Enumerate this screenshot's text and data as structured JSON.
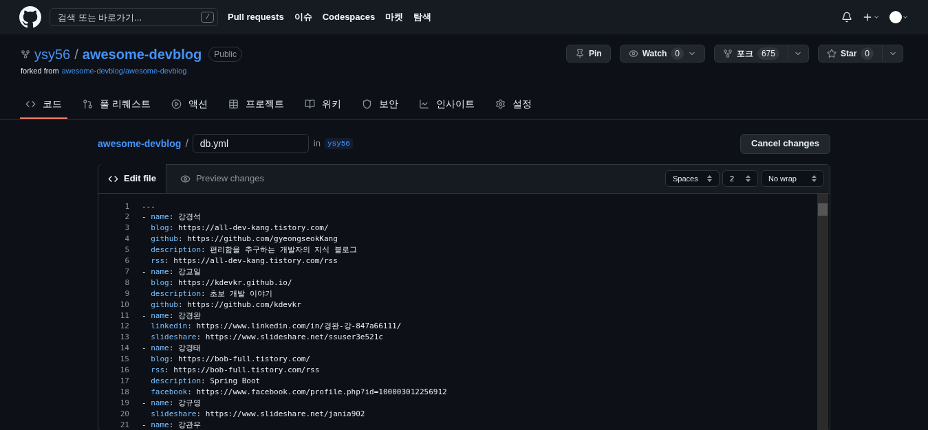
{
  "header": {
    "search_placeholder": "검색 또는 바로가기...",
    "search_key": "/",
    "nav": [
      "Pull requests",
      "이슈",
      "Codespaces",
      "마켓",
      "탐색"
    ]
  },
  "repo": {
    "owner": "ysy56",
    "separator": "/",
    "name": "awesome-devblog",
    "visibility": "Public",
    "forked_label": "forked from",
    "forked_link": "awesome-devblog/awesome-devblog",
    "actions": [
      {
        "kind": "pin",
        "label": "Pin"
      },
      {
        "kind": "watch",
        "label": "Watch",
        "count": "0"
      },
      {
        "kind": "fork",
        "label": "포크",
        "count": "675"
      },
      {
        "kind": "star",
        "label": "Star",
        "count": "0"
      }
    ]
  },
  "tabs": [
    {
      "kind": "code",
      "label": "코드",
      "selected": true
    },
    {
      "kind": "pr",
      "label": "풀 리퀘스트",
      "selected": false
    },
    {
      "kind": "actions",
      "label": "액션",
      "selected": false
    },
    {
      "kind": "projects",
      "label": "프로젝트",
      "selected": false
    },
    {
      "kind": "wiki",
      "label": "위키",
      "selected": false
    },
    {
      "kind": "security",
      "label": "보안",
      "selected": false
    },
    {
      "kind": "insights",
      "label": "인사이트",
      "selected": false
    },
    {
      "kind": "settings",
      "label": "설정",
      "selected": false
    }
  ],
  "editor": {
    "repo_link": "awesome-devblog",
    "separator": "/",
    "filename": "db.yml",
    "in_label": "in",
    "branch": "ysy56",
    "cancel": "Cancel changes",
    "modes": [
      {
        "kind": "edit",
        "label": "Edit file",
        "selected": true
      },
      {
        "kind": "preview",
        "label": "Preview changes",
        "selected": false
      }
    ],
    "selects": [
      "Spaces",
      "2",
      "No wrap"
    ],
    "lines": [
      {
        "number": "1",
        "text": "---"
      },
      {
        "number": "2",
        "dash": "-",
        "key": "name",
        "colon": ":",
        "value": "강경석"
      },
      {
        "number": "3",
        "key": "blog",
        "colon": ":",
        "value": "https://all-dev-kang.tistory.com/"
      },
      {
        "number": "4",
        "key": "github",
        "colon": ":",
        "value": "https://github.com/gyeongseokKang"
      },
      {
        "number": "5",
        "key": "description",
        "colon": ":",
        "value": "편리함을 추구하는 개발자의 지식 블로그"
      },
      {
        "number": "6",
        "key": "rss",
        "colon": ":",
        "value": "https://all-dev-kang.tistory.com/rss"
      },
      {
        "number": "7",
        "dash": "-",
        "key": "name",
        "colon": ":",
        "value": "강교일"
      },
      {
        "number": "8",
        "key": "blog",
        "colon": ":",
        "value": "https://kdevkr.github.io/"
      },
      {
        "number": "9",
        "key": "description",
        "colon": ":",
        "value": "초보 개발 이야기"
      },
      {
        "number": "10",
        "key": "github",
        "colon": ":",
        "value": "https://github.com/kdevkr"
      },
      {
        "number": "11",
        "dash": "-",
        "key": "name",
        "colon": ":",
        "value": "강경완"
      },
      {
        "number": "12",
        "key": "linkedin",
        "colon": ":",
        "value": "https://www.linkedin.com/in/경완-강-847a66111/"
      },
      {
        "number": "13",
        "key": "slideshare",
        "colon": ":",
        "value": "https://www.slideshare.net/ssuser3e521c"
      },
      {
        "number": "14",
        "dash": "-",
        "key": "name",
        "colon": ":",
        "value": "강경태"
      },
      {
        "number": "15",
        "key": "blog",
        "colon": ":",
        "value": "https://bob-full.tistory.com/"
      },
      {
        "number": "16",
        "key": "rss",
        "colon": ":",
        "value": "https://bob-full.tistory.com/rss"
      },
      {
        "number": "17",
        "key": "description",
        "colon": ":",
        "value": "Spring Boot"
      },
      {
        "number": "18",
        "key": "facebook",
        "colon": ":",
        "value": "https://www.facebook.com/profile.php?id=100003012256912"
      },
      {
        "number": "19",
        "dash": "-",
        "key": "name",
        "colon": ":",
        "value": "강규영"
      },
      {
        "number": "20",
        "key": "slideshare",
        "colon": ":",
        "value": "https://www.slideshare.net/jania902"
      },
      {
        "number": "21",
        "dash": "-",
        "key": "name",
        "colon": ":",
        "value": "강관우"
      }
    ]
  }
}
